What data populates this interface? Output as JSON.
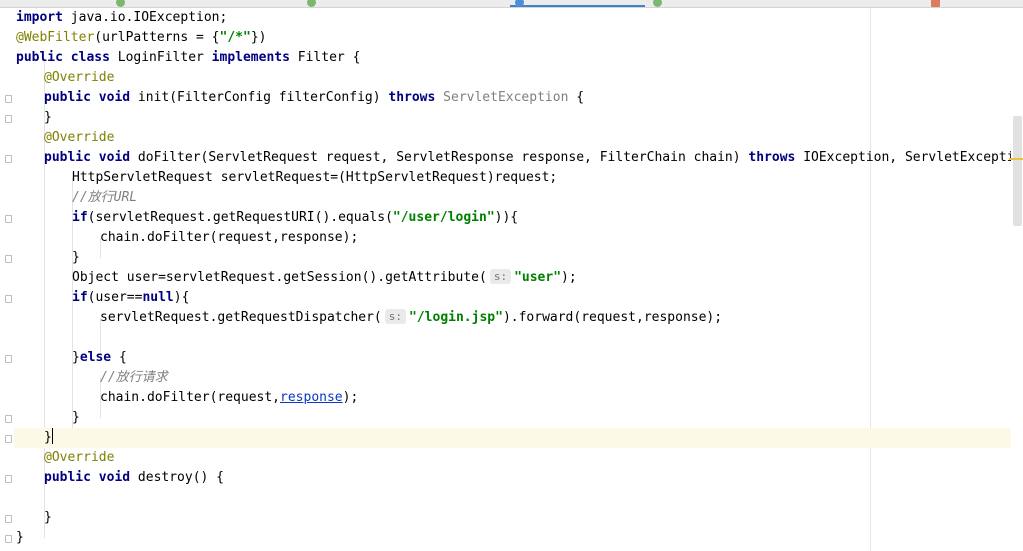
{
  "tabs": [
    {
      "label": "",
      "color": "#7bb86f"
    },
    {
      "label": "",
      "color": "#7bb86f"
    },
    {
      "label": "",
      "color": "#7bb86f"
    },
    {
      "label": "",
      "color": "#4b8fd4",
      "active": true
    },
    {
      "label": "",
      "color": "#7bb86f"
    },
    {
      "label": "",
      "color": "#e07a5f"
    }
  ],
  "code": {
    "l1": {
      "kw1": "import",
      "rest": " java.io.IOException;"
    },
    "l2": {
      "ann": "@WebFilter",
      "a": "(urlPatterns = {",
      "str": "\"/*\"",
      "b": "})"
    },
    "l3": {
      "kw1": "public class",
      "a": " LoginFilter ",
      "kw2": "implements",
      "b": " Filter {"
    },
    "l4": {
      "ann": "@Override"
    },
    "l5": {
      "kw1": "public void",
      "a": " init(FilterConfig filterConfig) ",
      "kw2": "throws",
      "grey": " ServletException",
      "b": " {"
    },
    "l6": {
      "a": "}"
    },
    "l7": {
      "ann": "@Override"
    },
    "l8": {
      "kw1": "public void",
      "a": " doFilter(ServletRequest request, ServletResponse response, FilterChain chain) ",
      "kw2": "throws",
      "b": " IOException, ServletException {"
    },
    "l9": {
      "a": "HttpServletRequest servletRequest=(HttpServletRequest)request;"
    },
    "l10": {
      "cmt": "//放行URL"
    },
    "l11": {
      "kw1": "if",
      "a": "(servletRequest.getRequestURI().equals(",
      "str": "\"/user/login\"",
      "b": ")){"
    },
    "l12": {
      "a": "chain.doFilter(request,response);"
    },
    "l13": {
      "a": "}"
    },
    "l14": {
      "a": "Object user=servletRequest.getSession().getAttribute(",
      "hint": "s:",
      "str": "\"user\"",
      "b": ");"
    },
    "l15": {
      "kw1": "if",
      "a": "(user==",
      "kw2": "null",
      "b": "){"
    },
    "l16": {
      "a": "servletRequest.getRequestDispatcher(",
      "hint": "s:",
      "str": "\"/login.jsp\"",
      "b": ").forward(request,response);"
    },
    "l18": {
      "a": "}",
      "kw1": "else",
      "b": " {"
    },
    "l19": {
      "cmt": "//放行请求"
    },
    "l20": {
      "a": "chain.doFilter(request,",
      "link": "response",
      "b": ");"
    },
    "l21": {
      "a": "}"
    },
    "l22": {
      "a": "}"
    },
    "l23": {
      "ann": "@Override"
    },
    "l24": {
      "kw1": "public void",
      "a": " destroy() {"
    },
    "l26": {
      "a": "}"
    },
    "l27": {
      "a": "}"
    }
  }
}
